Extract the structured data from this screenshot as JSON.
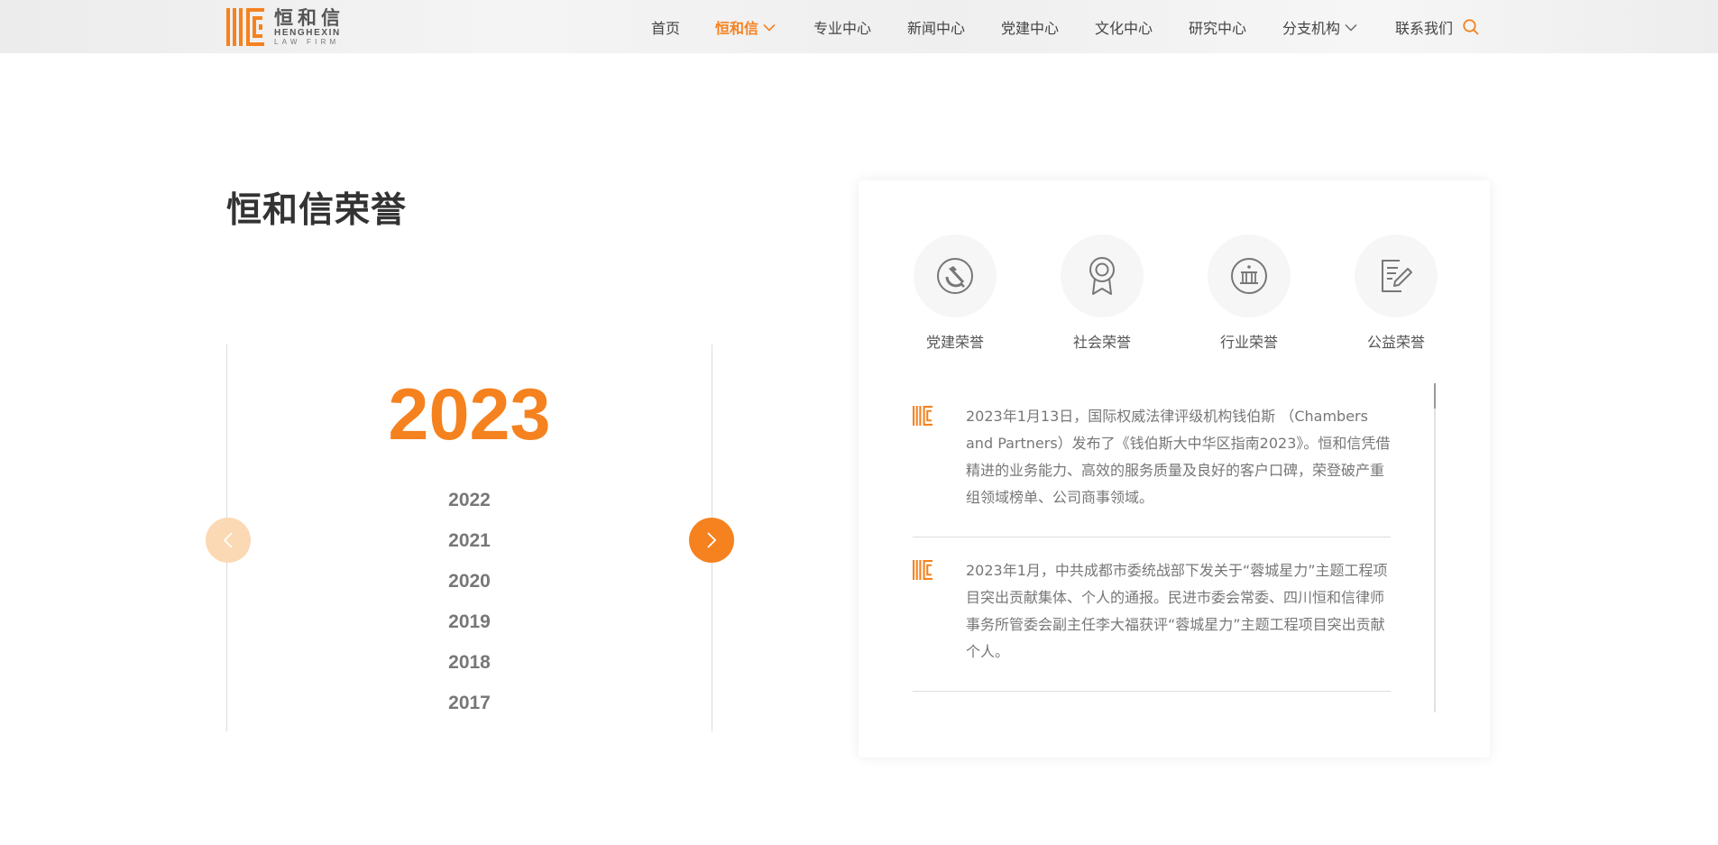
{
  "header": {
    "logo": {
      "cn": "恒和信",
      "en_line1": "HENGHEXIN",
      "en_line2": "LAW FIRM",
      "brand_color": "#f5821f"
    },
    "nav": [
      {
        "label": "首页",
        "active": false
      },
      {
        "label": "恒和信",
        "active": true,
        "dropdown": true
      },
      {
        "label": "专业中心",
        "active": false
      },
      {
        "label": "新闻中心",
        "active": false
      },
      {
        "label": "党建中心",
        "active": false
      },
      {
        "label": "文化中心",
        "active": false
      },
      {
        "label": "研究中心",
        "active": false
      },
      {
        "label": "分支机构",
        "active": false,
        "dropdown": true
      },
      {
        "label": "联系我们",
        "active": false
      }
    ],
    "search_icon": "search-icon"
  },
  "main": {
    "title": "恒和信荣誉",
    "years": {
      "current": "2023",
      "list": [
        "2022",
        "2021",
        "2020",
        "2019",
        "2018",
        "2017"
      ]
    },
    "categories": [
      {
        "label": "党建荣誉",
        "icon": "hammer-sickle-icon"
      },
      {
        "label": "社会荣誉",
        "icon": "medal-icon"
      },
      {
        "label": "行业荣誉",
        "icon": "court-icon"
      },
      {
        "label": "公益荣誉",
        "icon": "document-pen-icon"
      }
    ],
    "news": [
      {
        "text": "2023年1月13日，国际权威法律评级机构钱伯斯 （Chambers and Partners）发布了《钱伯斯大中华区指南2023》。恒和信凭借精进的业务能力、高效的服务质量及良好的客户口碑，荣登破产重组领域榜单、公司商事领域。"
      },
      {
        "text": "2023年1月，中共成都市委统战部下发关于“蓉城星力”主题工程项目突出贡献集体、个人的通报。民进市委会常委、四川恒和信律师事务所管委会副主任李大福获评“蓉城星力”主题工程项目突出贡献个人。"
      }
    ]
  },
  "colors": {
    "accent": "#f5821f",
    "accent_light": "#fbd9b4",
    "text_gray": "#777777"
  }
}
